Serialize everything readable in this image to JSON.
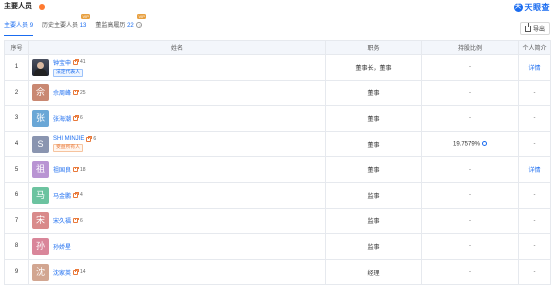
{
  "header": {
    "title": "主要人员",
    "logo_text": "天眼查",
    "logo_mark": "天"
  },
  "tabs": [
    {
      "label": "主要人员",
      "count": "9",
      "vip": ""
    },
    {
      "label": "历史主要人员",
      "count": "13",
      "vip": "VIP"
    },
    {
      "label": "董监高履历",
      "count": "22",
      "vip": "VIP"
    }
  ],
  "toolbar": {
    "export_label": "导出"
  },
  "table": {
    "headers": [
      "序号",
      "姓名",
      "职务",
      "持股比例",
      "个人简介"
    ],
    "rows": [
      {
        "index": "1",
        "avatar_char": "",
        "avatar_color": "",
        "name": "钟宝申",
        "count": "41",
        "tag": "法定代表人",
        "tag_type": "legal",
        "position": "董事长，董事",
        "ratio": "-",
        "bio": "详情"
      },
      {
        "index": "2",
        "avatar_char": "佘",
        "avatar_color": "#c98872",
        "name": "佘周峰",
        "count": "25",
        "tag": "",
        "tag_type": "",
        "position": "董事",
        "ratio": "-",
        "bio": "-"
      },
      {
        "index": "3",
        "avatar_char": "张",
        "avatar_color": "#6aa7d6",
        "name": "张海潮",
        "count": "6",
        "tag": "",
        "tag_type": "",
        "position": "董事",
        "ratio": "-",
        "bio": "-"
      },
      {
        "index": "4",
        "avatar_char": "S",
        "avatar_color": "#8a95b0",
        "name": "SHI MINJIE",
        "count": "6",
        "tag": "受益所有人",
        "tag_type": "benef",
        "position": "董事",
        "ratio": "19.7579%",
        "bio": "-"
      },
      {
        "index": "5",
        "avatar_char": "祖",
        "avatar_color": "#b994d3",
        "name": "祖国良",
        "count": "18",
        "tag": "",
        "tag_type": "",
        "position": "董事",
        "ratio": "-",
        "bio": "详情"
      },
      {
        "index": "6",
        "avatar_char": "马",
        "avatar_color": "#6cc3a0",
        "name": "马金鹏",
        "count": "4",
        "tag": "",
        "tag_type": "",
        "position": "监事",
        "ratio": "-",
        "bio": "-"
      },
      {
        "index": "7",
        "avatar_char": "宋",
        "avatar_color": "#d98a8a",
        "name": "宋久福",
        "count": "6",
        "tag": "",
        "tag_type": "",
        "position": "监事",
        "ratio": "-",
        "bio": "-"
      },
      {
        "index": "8",
        "avatar_char": "孙",
        "avatar_color": "#d9869a",
        "name": "孙娇星",
        "count": "",
        "tag": "",
        "tag_type": "",
        "position": "监事",
        "ratio": "-",
        "bio": "-"
      },
      {
        "index": "9",
        "avatar_char": "沈",
        "avatar_color": "#d2a691",
        "name": "沈家英",
        "count": "14",
        "tag": "",
        "tag_type": "",
        "position": "经理",
        "ratio": "-",
        "bio": "-"
      }
    ]
  }
}
